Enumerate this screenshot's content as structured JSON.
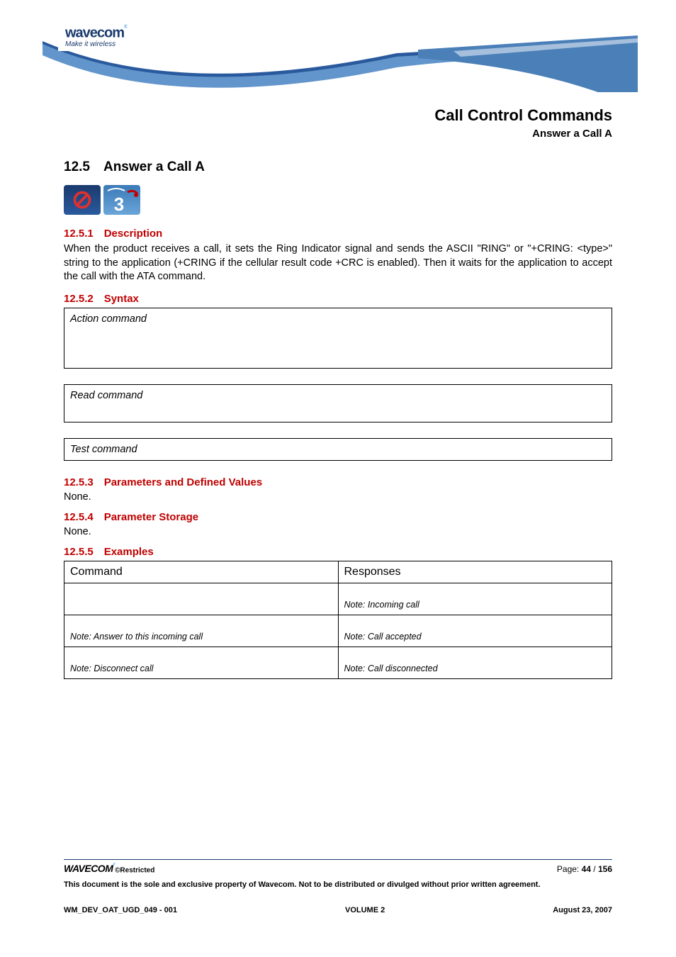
{
  "logo": {
    "brand": "wavecom",
    "tagline": "Make it wireless"
  },
  "header": {
    "title": "Call Control Commands",
    "subtitle": "Answer a Call A"
  },
  "section": {
    "num_title": "12.5 Answer a Call A",
    "desc": {
      "heading": "12.5.1 Description",
      "body": "When the product receives a call, it sets the Ring Indicator signal and sends the ASCII \"RING\" or \"+CRING: <type>\" string to the application (+CRING if the cellular result code +CRC is enabled). Then it waits for the application to accept the call with the ATA command."
    },
    "syntax": {
      "heading": "12.5.2 Syntax",
      "action": "Action command",
      "read": "Read command",
      "test": "Test command"
    },
    "params": {
      "heading": "12.5.3 Parameters and Defined Values",
      "body": "None."
    },
    "storage": {
      "heading": "12.5.4 Parameter Storage",
      "body": "None."
    },
    "examples": {
      "heading": "12.5.5 Examples",
      "col1": "Command",
      "col2": "Responses",
      "rows": [
        {
          "cmd": "",
          "resp_note": "Note: Incoming call"
        },
        {
          "cmd_note": "Note: Answer to this incoming call",
          "resp_note": "Note: Call accepted"
        },
        {
          "cmd_note": "Note: Disconnect call",
          "resp_note": "Note: Call disconnected"
        }
      ]
    }
  },
  "footer": {
    "brand": "wavecom",
    "restricted": "©Restricted",
    "page_label": "Page: ",
    "page_current": "44",
    "page_sep": " / ",
    "page_total": "156",
    "disclaimer": "This document is the sole and exclusive property of Wavecom. Not to be distributed or divulged without prior written agreement.",
    "docid": "WM_DEV_OAT_UGD_049 - 001",
    "volume": "VOLUME 2",
    "date": "August 23, 2007"
  }
}
